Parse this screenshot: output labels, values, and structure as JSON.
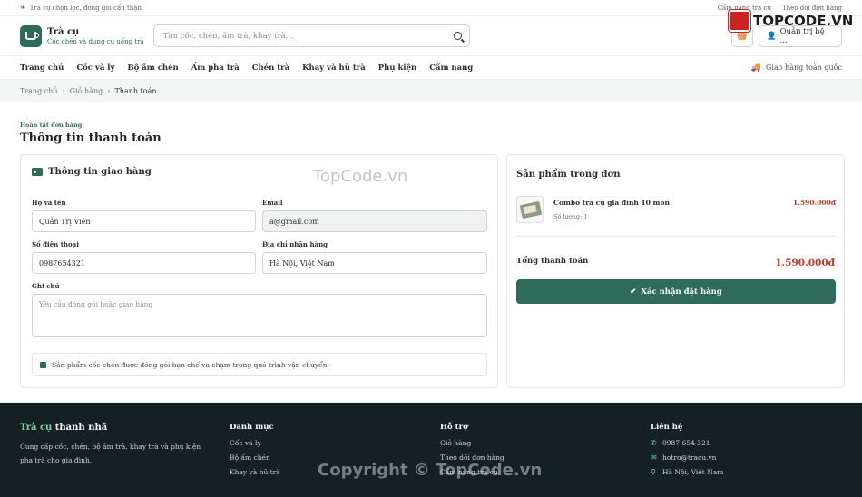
{
  "topbar": {
    "tagline": "Trà cụ chọn lọc, đóng gói cẩn thận",
    "links": [
      "Cẩm nang trà cụ",
      "Theo dõi đơn hàng"
    ]
  },
  "header": {
    "brand_name": "Trà cụ",
    "brand_tagline": "Cốc chén và dụng cụ uống trà",
    "search_placeholder": "Tìm cốc, chén, ấm trà, khay trà...",
    "user_label": "Quản trị hệ ..."
  },
  "nav": {
    "items": [
      "Trang chủ",
      "Cốc và ly",
      "Bộ ấm chén",
      "Ấm pha trà",
      "Chén trà",
      "Khay và hũ trà",
      "Phụ kiện",
      "Cẩm nang"
    ],
    "shipping": "Giao hàng toàn quốc"
  },
  "breadcrumb": [
    "Trang chủ",
    "Giỏ hàng",
    "Thanh toán"
  ],
  "page": {
    "eyebrow": "Hoàn tất đơn hàng",
    "title": "Thông tin thanh toán"
  },
  "shipping_form": {
    "title": "Thông tin giao hàng",
    "name_label": "Họ và tên",
    "name_value": "Quản Trị Viên",
    "email_label": "Email",
    "email_value": "a@gmail.com",
    "phone_label": "Số điện thoại",
    "phone_value": "0987654321",
    "address_label": "Địa chỉ nhận hàng",
    "address_value": "Hà Nội, Việt Nam",
    "note_label": "Ghi chú",
    "note_placeholder": "Yêu cầu đóng gói hoặc giao hàng",
    "notice": "Sản phẩm cốc chén được đóng gói hạn chế va chạm trong quá trình vận chuyển."
  },
  "order": {
    "title": "Sản phẩm trong đơn",
    "item_name": "Combo trà cụ gia đình 10 món",
    "item_qty": "Số lượng: 1",
    "item_price": "1.590.000đ",
    "total_label": "Tổng thanh toán",
    "total_value": "1.590.000đ",
    "confirm_label": "Xác nhận đặt hàng"
  },
  "footer": {
    "brand_a": "Trà cụ",
    "brand_b": "thanh nhã",
    "description": "Cung cấp cốc, chén, bộ ấm trà, khay trà và phụ kiện pha trà cho gia đình.",
    "cat_title": "Danh mục",
    "cat_links": [
      "Cốc và ly",
      "Bộ ấm chén",
      "Khay và hũ trà"
    ],
    "support_title": "Hỗ trợ",
    "support_links": [
      "Giỏ hàng",
      "Theo dõi đơn hàng",
      "Cẩm nang trà cụ"
    ],
    "contact_title": "Liên hệ",
    "phone": "0987 654 321",
    "email": "hotro@tracu.vn",
    "location": "Hà Nội, Việt Nam"
  },
  "watermarks": {
    "center": "TopCode.vn",
    "footer": "Copyright © TopCode.vn",
    "logo": "TOPCODE.VN"
  },
  "colors": {
    "accent": "#2f6b5a",
    "price": "#c0392b",
    "footer_bg": "#152024"
  }
}
